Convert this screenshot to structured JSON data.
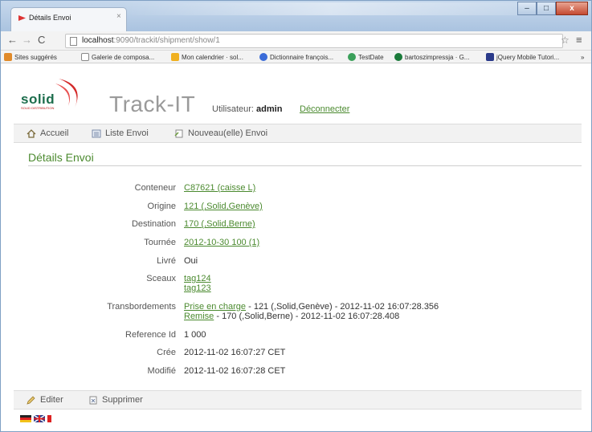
{
  "browser": {
    "tab_title": "Détails Envoi",
    "tab_close": "×",
    "window_minimize": "–",
    "window_maximize": "□",
    "window_close": "x",
    "url_host": "localhost",
    "url_path": ":9090/trackit/shipment/show/1",
    "bookmarks": [
      {
        "label": "Sites suggérés",
        "color": "#e08a2a"
      },
      {
        "label": "Galerie de composa...",
        "color": "#ffffff"
      },
      {
        "label": "Mon calendrier · sol...",
        "color": "#f0b020"
      },
      {
        "label": "Dictionnaire françois...",
        "color": "#3a6bd8"
      },
      {
        "label": "TestDate",
        "color": "#3aa05a"
      },
      {
        "label": "bartoszimpressja · G...",
        "color": "#1a7a3a"
      },
      {
        "label": "jQuery Mobile Tutori...",
        "color": "#2a3a8a"
      }
    ],
    "bookmarks_more": "»"
  },
  "app": {
    "logo_text": "solid",
    "logo_sub": "SOLID DISTRIBUTION",
    "title": "Track-IT",
    "user_label": "Utilisateur:",
    "user_name": "admin",
    "logout": "Déconnecter"
  },
  "menu": {
    "home": "Accueil",
    "list": "Liste Envoi",
    "new": "Nouveau(elle) Envoi"
  },
  "section_title": "Détails Envoi",
  "fields": {
    "conteneur_label": "Conteneur",
    "conteneur_value": "C87621 (caisse L)",
    "origine_label": "Origine",
    "origine_value": "121 (,Solid,Genève)",
    "destination_label": "Destination",
    "destination_value": "170 (,Solid,Berne)",
    "tournee_label": "Tournée",
    "tournee_value": "2012-10-30 100 (1)",
    "livre_label": "Livré",
    "livre_value": "Oui",
    "sceaux_label": "Sceaux",
    "sceaux_values": [
      "tag124",
      "tag123"
    ],
    "transbordements_label": "Transbordements",
    "transbordements": [
      {
        "link": "Prise en charge",
        "text": " - 121 (,Solid,Genève) - 2012-11-02 16:07:28.356"
      },
      {
        "link": "Remise",
        "text": " - 170 (,Solid,Berne) - 2012-11-02 16:07:28.408"
      }
    ],
    "reference_label": "Reference Id",
    "reference_value": "1 000",
    "cree_label": "Crée",
    "cree_value": "2012-11-02 16:07:27 CET",
    "modifie_label": "Modifié",
    "modifie_value": "2012-11-02 16:07:28 CET"
  },
  "footer": {
    "edit": "Editer",
    "delete": "Supprimer"
  }
}
